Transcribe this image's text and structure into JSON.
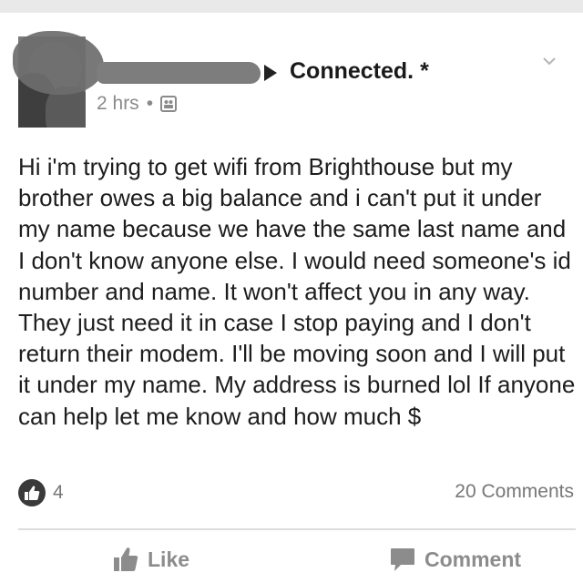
{
  "post": {
    "group_name": "Connected. *",
    "time": "2 hrs",
    "separator": "•",
    "privacy_icon": "group-privacy-icon",
    "text": "Hi i'm trying to get wifi from Brighthouse but my brother owes a big balance and i can't put it under my name because we have the same last name and I don't know anyone else. I would need someone's id number and name. It won't affect you in any way. They just need it in case I stop paying and I don't return their modem. I'll be moving soon and I will put it under my name. My address is burned lol If anyone can help let me know and how much $",
    "like_count": "4",
    "comments_count": "20 Comments"
  },
  "actions": {
    "like_label": "Like",
    "comment_label": "Comment"
  }
}
